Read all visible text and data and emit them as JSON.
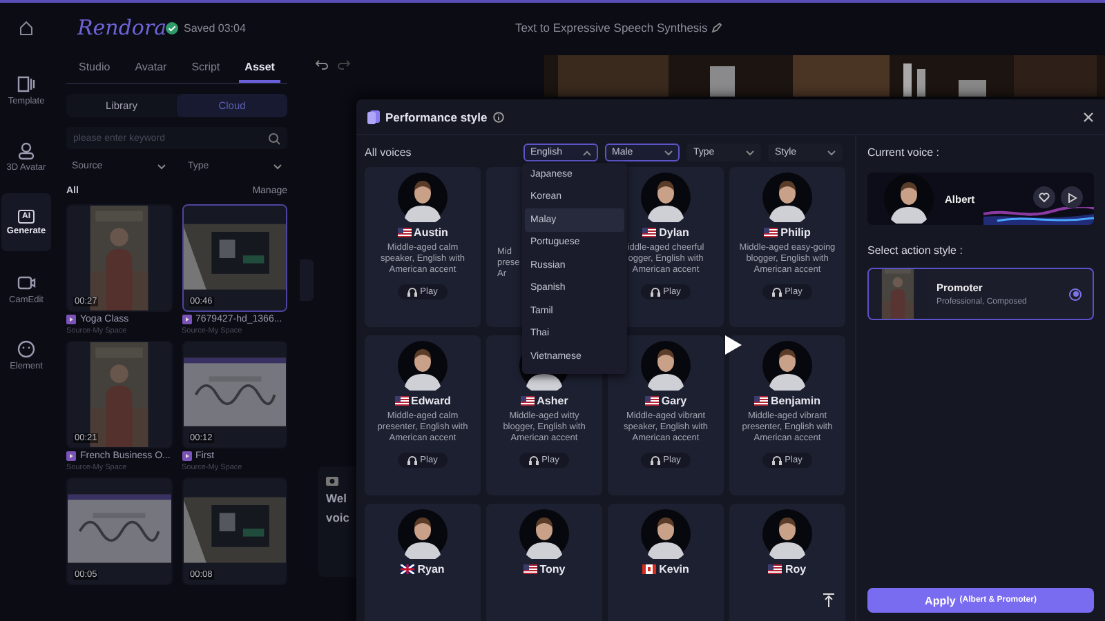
{
  "app": {
    "logo": "Rendora",
    "saved": "Saved 03:04",
    "title": "Text to Expressive Speech Synthesis"
  },
  "rail": [
    {
      "label": "Template",
      "kind": "template",
      "selected": false
    },
    {
      "label": "3D Avatar",
      "kind": "avatar",
      "selected": false
    },
    {
      "label": "Generate",
      "kind": "ai",
      "badge": "AI",
      "selected": true
    },
    {
      "label": "CamEdit",
      "kind": "camera",
      "selected": false
    },
    {
      "label": "Element",
      "kind": "element",
      "selected": false
    }
  ],
  "panel": {
    "tabs": [
      {
        "label": "Studio",
        "selected": false
      },
      {
        "label": "Avatar",
        "selected": false
      },
      {
        "label": "Script",
        "selected": false
      },
      {
        "label": "Asset",
        "selected": true
      }
    ],
    "segments": [
      {
        "label": "Library",
        "selected": false
      },
      {
        "label": "Cloud",
        "selected": true
      }
    ],
    "search": {
      "placeholder": "please enter keyword"
    },
    "filters": [
      "Source",
      "Type"
    ],
    "section": "All",
    "manage": "Manage",
    "assets": [
      {
        "duration": "00:27",
        "title": "Yoga Class",
        "source": "Source-My Space",
        "kind": "person",
        "selected": false
      },
      {
        "duration": "00:46",
        "title": "7679427-hd_1366...",
        "source": "Source-My Space",
        "kind": "room",
        "selected": true
      },
      {
        "duration": "00:21",
        "title": "French Business O...",
        "source": "Source-My Space",
        "kind": "person",
        "selected": false
      },
      {
        "duration": "00:12",
        "title": "First",
        "source": "Source-My Space",
        "kind": "slide",
        "selected": false
      },
      {
        "duration": "00:05",
        "kind": "slide",
        "selected": false
      },
      {
        "duration": "00:08",
        "kind": "room",
        "selected": false
      }
    ]
  },
  "canvas": {
    "lines": [
      "Wel",
      "voic"
    ]
  },
  "modal": {
    "title": "Performance style",
    "filter_label": "All voices",
    "filters": [
      {
        "label": "English",
        "active": true,
        "open": true
      },
      {
        "label": "Male",
        "active": true,
        "open": false
      },
      {
        "label": "Type",
        "active": false,
        "open": false
      },
      {
        "label": "Style",
        "active": false,
        "open": false
      }
    ],
    "dropdown": [
      {
        "label": "Japanese",
        "selected": false
      },
      {
        "label": "Korean",
        "selected": false
      },
      {
        "label": "Malay",
        "selected": true
      },
      {
        "label": "Portuguese",
        "selected": false
      },
      {
        "label": "Russian",
        "selected": false
      },
      {
        "label": "Spanish",
        "selected": false
      },
      {
        "label": "Tamil",
        "selected": false
      },
      {
        "label": "Thai",
        "selected": false
      },
      {
        "label": "Vietnamese",
        "selected": false
      }
    ],
    "voices": [
      {
        "kind": "full",
        "name": "Austin",
        "flag": {
          "kind": "us"
        },
        "description": "Middle-aged calm speaker, English with American accent",
        "play": "Play"
      },
      {
        "kind": "covered",
        "fragments": [
          "Mid",
          "prese",
          "Ar"
        ]
      },
      {
        "kind": "full",
        "name": "Dylan",
        "flag": {
          "kind": "us"
        },
        "description": "iddle-aged cheerful ogger, English with American accent",
        "play": "Play"
      },
      {
        "kind": "full",
        "name": "Philip",
        "flag": {
          "kind": "us"
        },
        "description": "Middle-aged easy-going blogger, English with American accent",
        "play": "Play"
      },
      {
        "kind": "full",
        "name": "Edward",
        "flag": {
          "kind": "us"
        },
        "description": "Middle-aged calm presenter, English with American accent",
        "play": "Play"
      },
      {
        "kind": "full",
        "name": "Asher",
        "flag": {
          "kind": "us"
        },
        "description": "Middle-aged witty blogger, English with American accent",
        "play": "Play"
      },
      {
        "kind": "full",
        "name": "Gary",
        "flag": {
          "kind": "us"
        },
        "description": "Middle-aged vibrant speaker, English with American accent",
        "play": "Play"
      },
      {
        "kind": "full",
        "name": "Benjamin",
        "flag": {
          "kind": "us"
        },
        "description": "Middle-aged vibrant presenter, English with American accent",
        "play": "Play"
      },
      {
        "kind": "full",
        "name": "Ryan",
        "flag": {
          "kind": "uk"
        }
      },
      {
        "kind": "full",
        "name": "Tony",
        "flag": {
          "kind": "us"
        }
      },
      {
        "kind": "full",
        "name": "Kevin",
        "flag": {
          "kind": "ca"
        }
      },
      {
        "kind": "full",
        "name": "Roy",
        "flag": {
          "kind": "us"
        }
      }
    ],
    "current_label": "Current voice :",
    "current_voice": "Albert",
    "style_label": "Select action style :",
    "styles": [
      {
        "name": "Promoter",
        "tags": "Professional, Composed",
        "selected": true
      }
    ],
    "apply": "Apply",
    "apply_detail": "(Albert & Promoter)"
  }
}
